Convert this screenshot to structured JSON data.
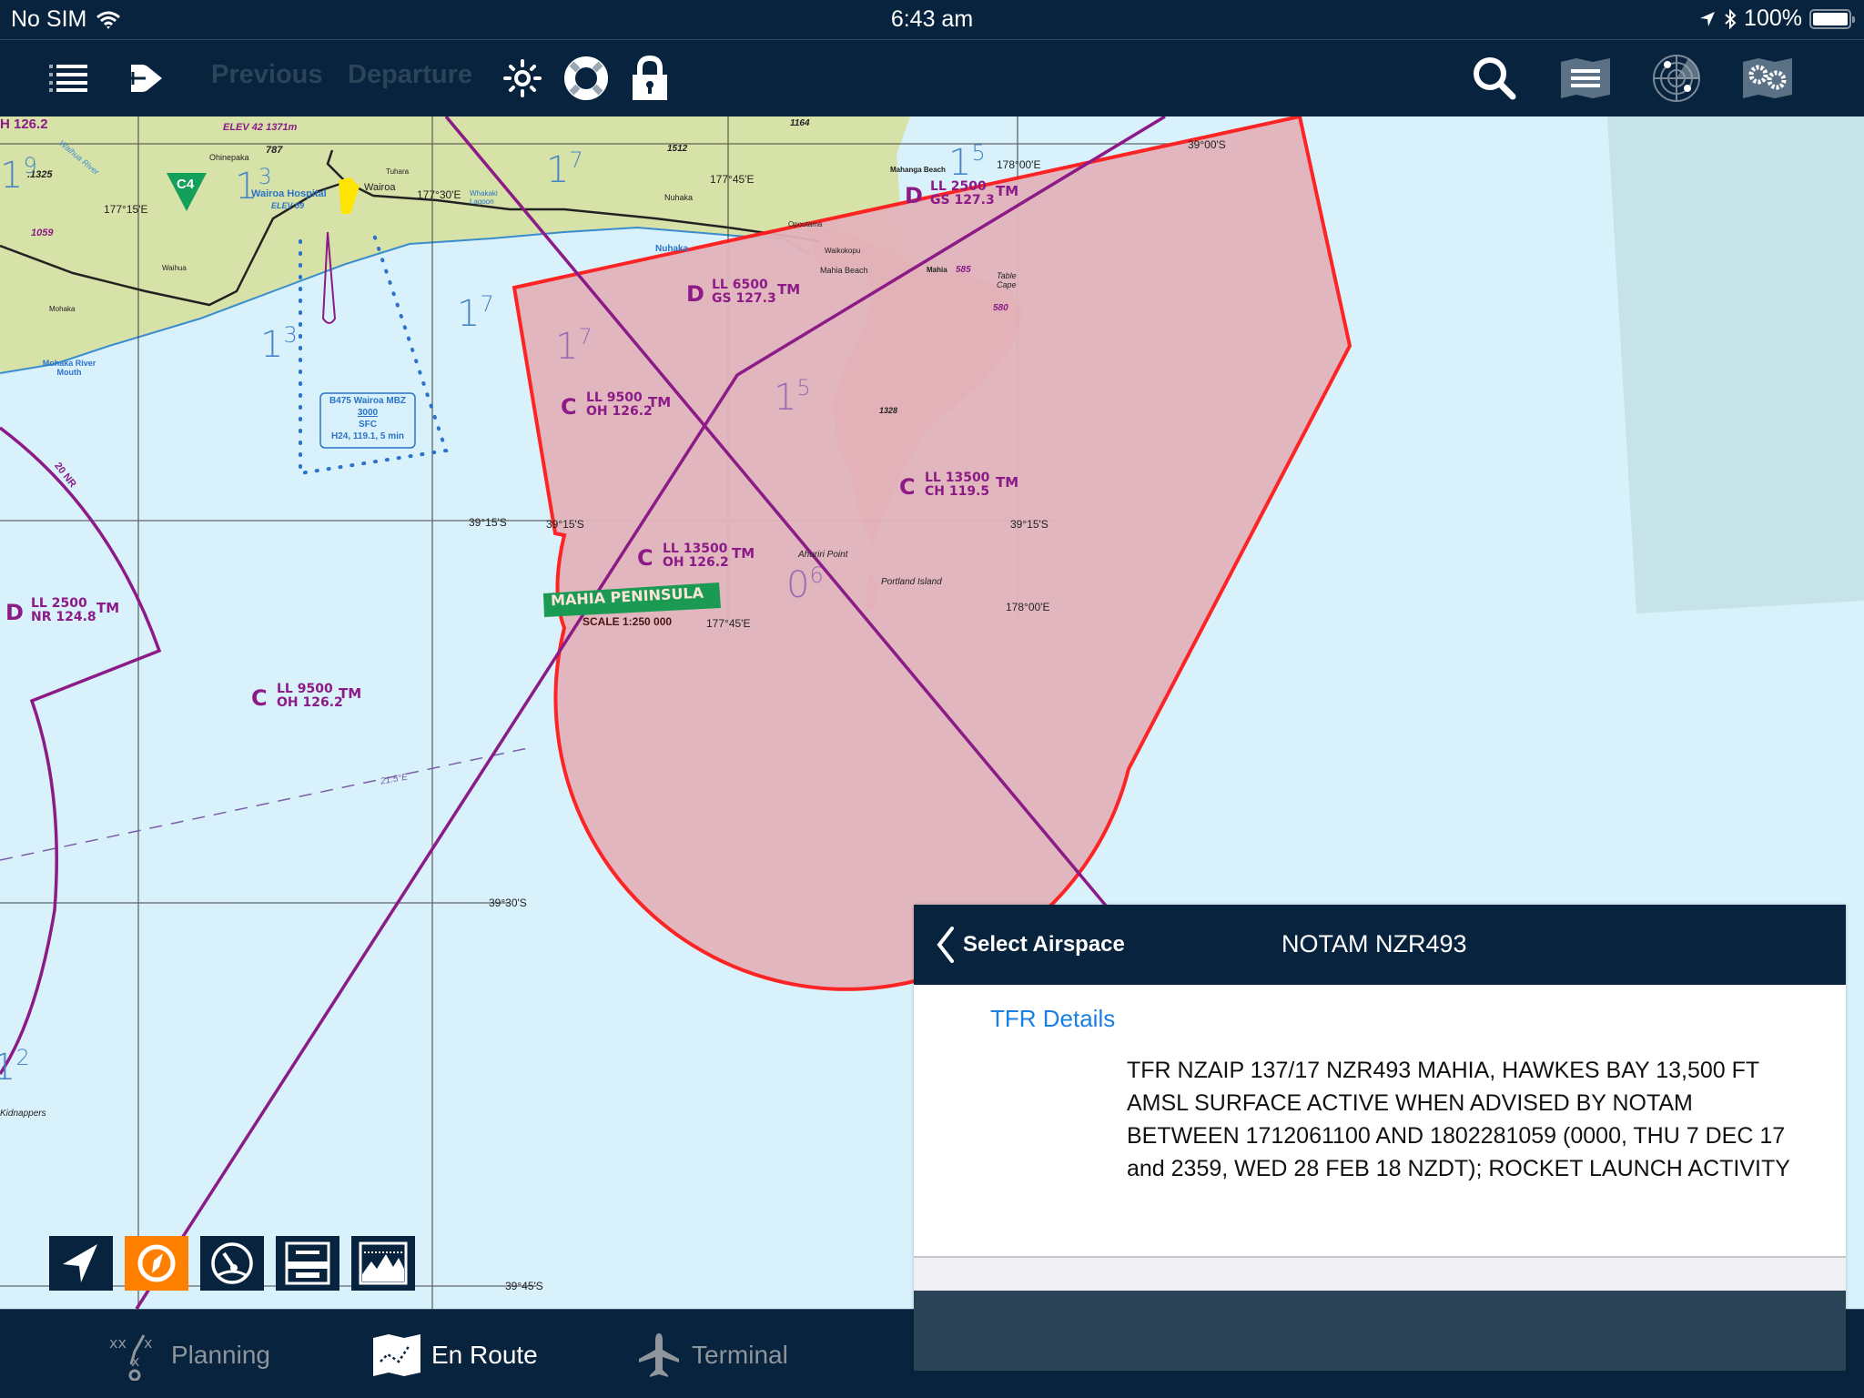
{
  "status_bar": {
    "carrier": "No SIM",
    "time": "6:43 am",
    "battery": "100%",
    "battery_level": 1.0,
    "icons": [
      "wifi-icon",
      "location-arrow-icon",
      "bluetooth-icon",
      "battery-icon"
    ]
  },
  "toolbar": {
    "left_icons": [
      "list-icon",
      "direct-to-icon"
    ],
    "previous_label": "Previous",
    "departure_label": "Departure",
    "mid_icons": [
      "brightness-icon",
      "lifebuoy-icon",
      "lock-icon"
    ],
    "right_icons": [
      "search-icon",
      "map-layers-icon",
      "radar-icon",
      "map-settings-icon"
    ]
  },
  "map": {
    "labels": {
      "top_left_freq": "H 126.2",
      "elev_top": "ELEV 42  1371m",
      "ohinepaka": "Ohinepaka",
      "spot_787": "787",
      "spot_1325": ".1325",
      "spot_1059": "1059",
      "spot_1512": "1512",
      "spot_1164": "1164",
      "c4": "C4",
      "wairoa_hospital": "Wairoa Hospital",
      "wairoa_elev": "ELEV 59",
      "wairoa": "Wairoa",
      "tuhara": "Tuhara",
      "whakaki": "Whakaki",
      "whakaki_lagoon": "Whakaki Lagoon",
      "nuhaka": "Nuhaka",
      "nuhaka_blue": "Nuhaka",
      "waihua": "Waihua",
      "waihua_river": "Waihua River",
      "mohaka": "Mohaka",
      "mohaka_river_mouth": "Mohaka River Mouth",
      "lon_17715": "177°15'E",
      "lon_17730": "177°30'E",
      "lon_17745_top": "177°45'E",
      "lon_17745_bottom": "177°45'E",
      "lon_178_top": "178°00'E",
      "lon_178_bottom": "178°00'E",
      "lat_3900": "39°00'S",
      "lat_3915_left": "39°15'S",
      "lat_3915_mid": "39°15'S",
      "lat_3915_right": "39°15'S",
      "lat_3930": "39°30'S",
      "lat_3945": "39°45'S",
      "mahanga_beach": "Mahanga Beach",
      "opoutama": "Opoutama",
      "waikokopu": "Waikokopu",
      "mahia_beach": "Mahia Beach",
      "mahia": "Mahia",
      "spot_585": "585",
      "spot_580": "580",
      "table_cape": "Table Cape",
      "spot_1328": "1328",
      "ahuriri_point": "Ahuriri Point",
      "portland_island": "Portland Island",
      "mahia_peninsula": "MAHIA PENINSULA",
      "scale": "SCALE 1:250 000",
      "arc_20nr": "20 NR",
      "isogonic": "21.5°E",
      "kidnappers": "Kidnappers",
      "mbz_box": [
        "B475 Wairoa MBZ",
        "3000",
        "SFC",
        "H24, 119.1, 5 min"
      ]
    },
    "grid_numbers": [
      {
        "main": "1",
        "sup": "9"
      },
      {
        "main": "1",
        "sup": "3"
      },
      {
        "main": "1",
        "sup": "7"
      },
      {
        "main": "1",
        "sup": "3"
      },
      {
        "main": "1",
        "sup": "7"
      },
      {
        "main": "1",
        "sup": "5"
      },
      {
        "main": "1",
        "sup": "7"
      },
      {
        "main": "1",
        "sup": "5"
      },
      {
        "main": "0",
        "sup": "6"
      },
      {
        "main": "1",
        "sup": "2"
      }
    ],
    "airspace_labels": [
      {
        "class": "D",
        "line1": "LL 6500",
        "line2": "GS  127.3",
        "suffix": "TM"
      },
      {
        "class": "D",
        "line1": "LL 2500",
        "line2": "GS  127.3",
        "suffix": "TM"
      },
      {
        "class": "C",
        "line1": "LL 9500",
        "line2": "OH  126.2",
        "suffix": "TM"
      },
      {
        "class": "C",
        "line1": "LL 13500",
        "line2": "CH  119.5",
        "suffix": "TM"
      },
      {
        "class": "C",
        "line1": "LL 13500",
        "line2": "OH 126.2",
        "suffix": "TM"
      },
      {
        "class": "D",
        "line1": "LL 2500",
        "line2": "NR 124.8",
        "suffix": "TM"
      },
      {
        "class": "C",
        "line1": "LL 9500",
        "line2": "OH 126.2",
        "suffix": "TM"
      }
    ],
    "tfr_color": "#ff1a1a",
    "tfr_fill": "#e2b3bb",
    "airspace_color": "#8c1a87"
  },
  "map_tools": [
    {
      "name": "track-up-icon",
      "active": false
    },
    {
      "name": "compass-icon",
      "active": true
    },
    {
      "name": "instruments-icon",
      "active": false
    },
    {
      "name": "flight-plan-strip-icon",
      "active": false
    },
    {
      "name": "terrain-profile-icon",
      "active": false
    }
  ],
  "tabs": [
    {
      "label": "Planning",
      "icon": "planning-icon",
      "active": false
    },
    {
      "label": "En Route",
      "icon": "en-route-map-icon",
      "active": true
    },
    {
      "label": "Terminal",
      "icon": "airplane-icon",
      "active": false
    }
  ],
  "notam_panel": {
    "back_label": "Select Airspace",
    "title": "NOTAM NZR493",
    "section_link": "TFR Details",
    "body": "TFR NZAIP 137/17 NZR493 MAHIA, HAWKES BAY 13,500 FT AMSL SURFACE ACTIVE WHEN ADVISED BY NOTAM BETWEEN 1712061100 AND 1802281059 (0000, THU 7 DEC 17 and 2359, WED 28 FEB 18 NZDT); ROCKET LAUNCH ACTIVITY"
  }
}
